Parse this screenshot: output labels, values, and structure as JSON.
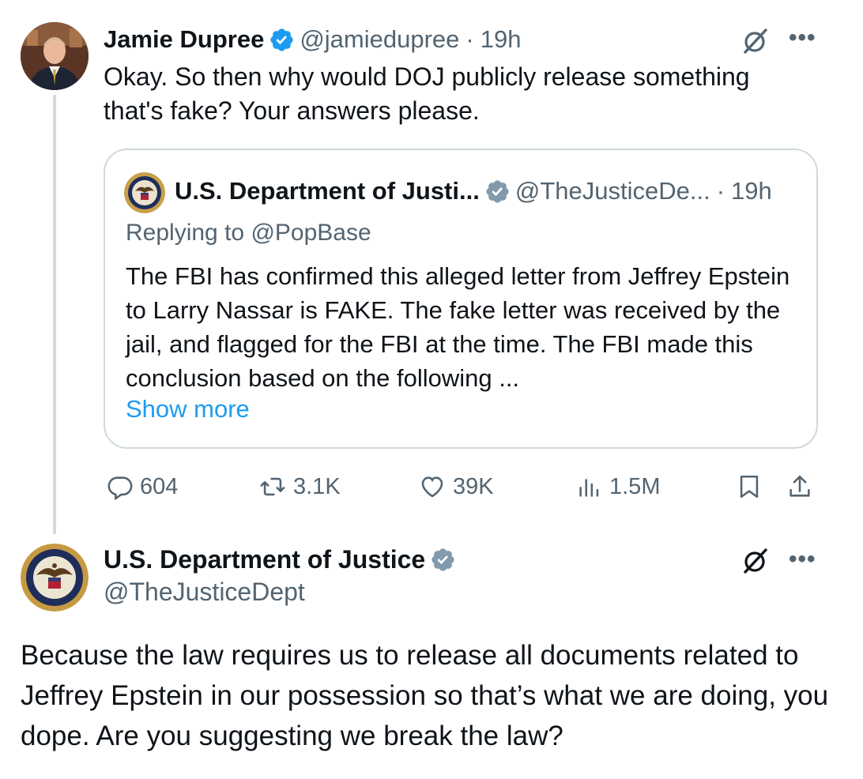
{
  "tweet1": {
    "name": "Jamie Dupree",
    "handle": "@jamiedupree",
    "separator": "·",
    "time": "19h",
    "text": "Okay.  So then why would DOJ publicly release something that's fake?  Your answers please.",
    "avatar_icon": "person-avatar"
  },
  "quote": {
    "name": "U.S. Department of Justi...",
    "handle": "@TheJusticeDe...",
    "separator": "·",
    "time": "19h",
    "replying_prefix": "Replying to ",
    "replying_handle": "@PopBase",
    "text": "The FBI has confirmed this alleged letter from Jeffrey Epstein to Larry Nassar is FAKE. The fake letter was received by the jail, and flagged for the FBI at the time. The FBI made this conclusion based on the following ...",
    "show_more": "Show more",
    "avatar_icon": "doj-seal"
  },
  "actions": {
    "replies": "604",
    "reposts": "3.1K",
    "likes": "39K",
    "views": "1.5M"
  },
  "tweet2": {
    "name": "U.S. Department of Justice",
    "handle": "@TheJusticeDept",
    "text": "Because the law requires us to release all documents related to Jeffrey Epstein in our possession so that’s what we are doing, you dope. Are you suggesting we break the law?",
    "avatar_icon": "doj-seal"
  },
  "colors": {
    "verified_blue": "#1d9bf0",
    "verified_gray": "#829aab",
    "link_blue": "#1d9bf0",
    "secondary_text": "#536471",
    "border": "#cfd9de"
  }
}
